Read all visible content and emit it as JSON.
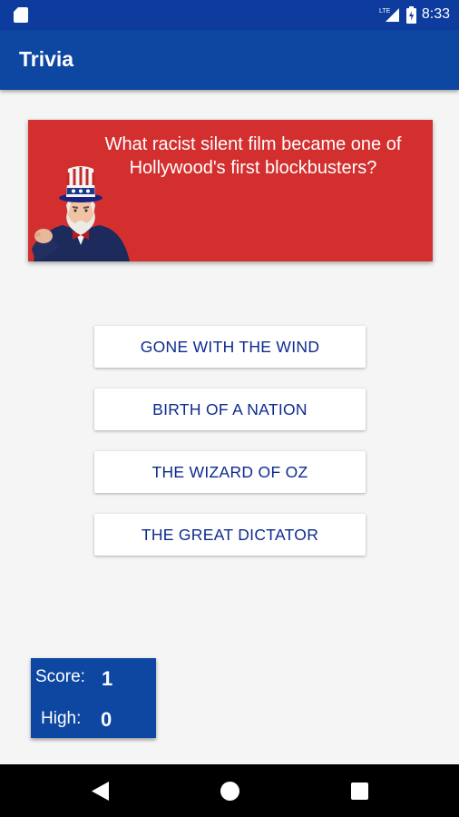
{
  "status_bar": {
    "time": "8:33",
    "network": "LTE",
    "icons": [
      "sd-card-icon",
      "signal-icon",
      "battery-icon"
    ]
  },
  "app_bar": {
    "title": "Trivia"
  },
  "question": {
    "text": "What racist silent film became one of Hollywood's first blockbusters?",
    "image": "uncle-sam-icon"
  },
  "answers": [
    "GONE WITH THE WIND",
    "BIRTH OF A NATION",
    "THE WIZARD OF OZ",
    "THE GREAT DICTATOR"
  ],
  "score": {
    "score_label": "Score:",
    "score_value": "1",
    "high_label": "High:",
    "high_value": "0"
  },
  "nav": {
    "icons": [
      "back-icon",
      "home-icon",
      "recents-icon"
    ]
  },
  "colors": {
    "primary": "#0d47a1",
    "status_bar": "#0d3c9e",
    "question_card": "#d32f2f",
    "answer_text": "#0d2b8e",
    "background": "#f5f5f5"
  }
}
